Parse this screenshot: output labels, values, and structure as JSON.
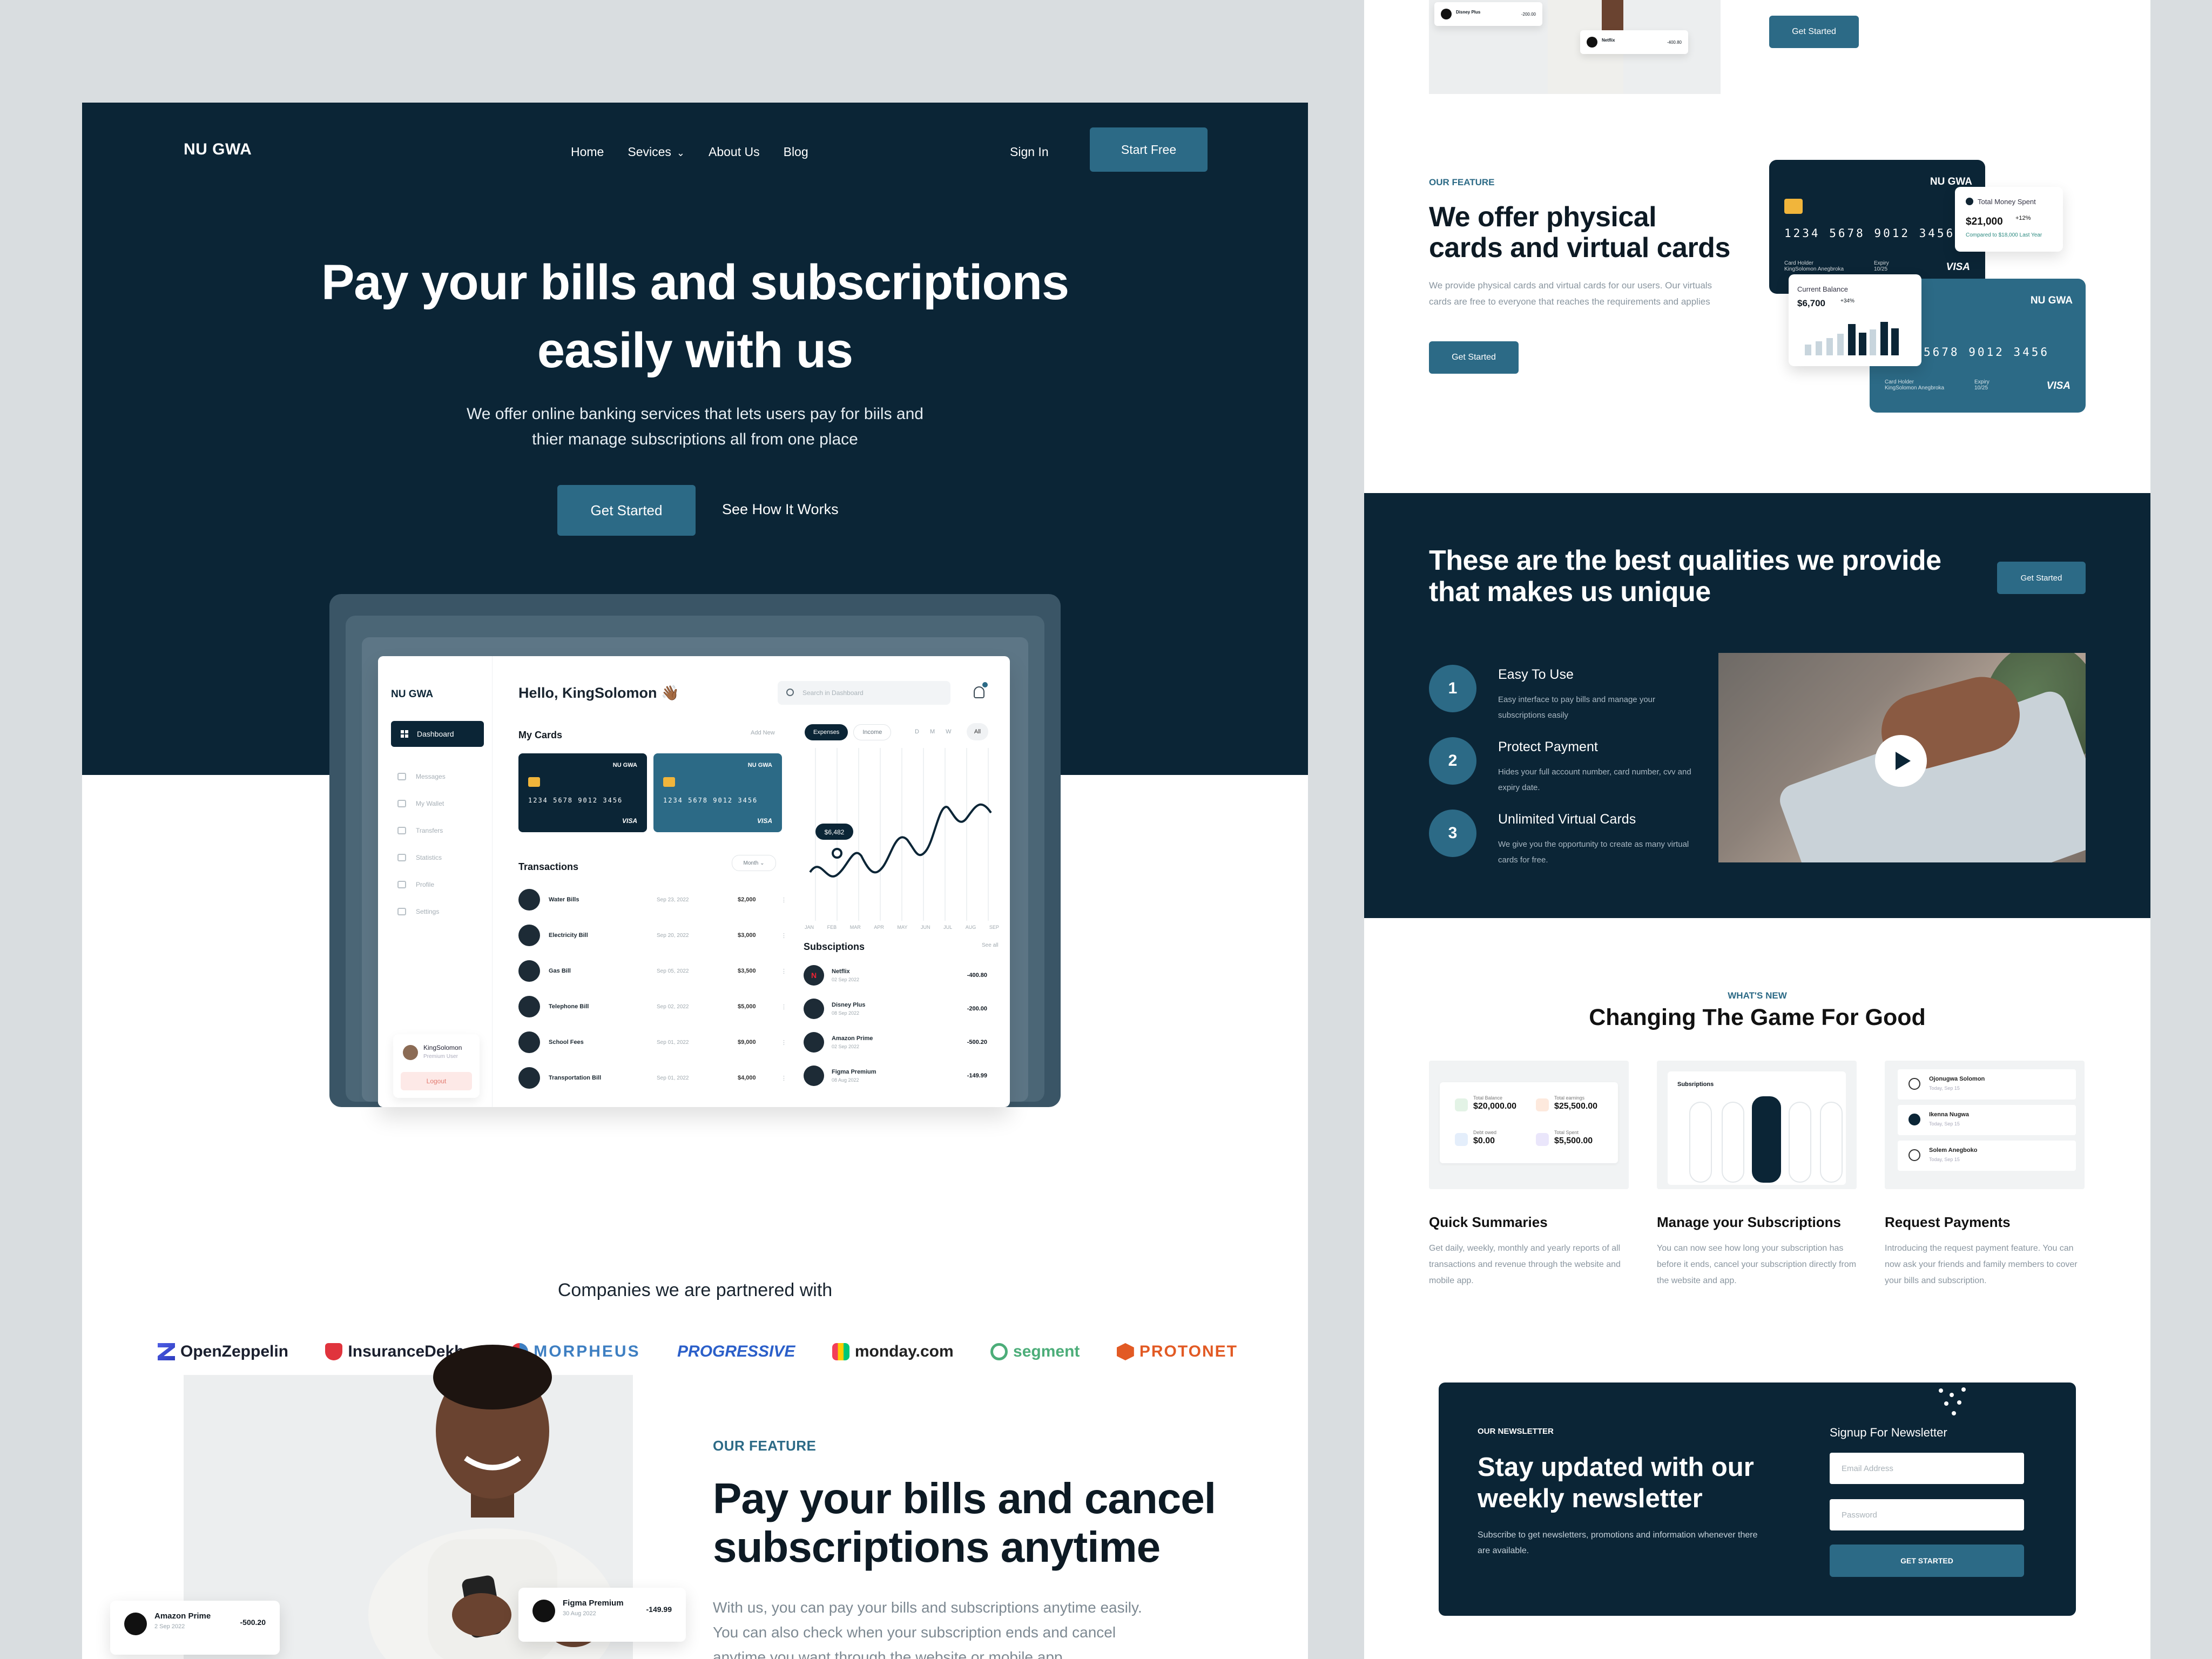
{
  "colors": {
    "navy": "#0b2536",
    "teal": "#2c6a86",
    "background": "#d9dde0"
  },
  "left": {
    "nav": {
      "logo": "NU GWA",
      "links": [
        "Home",
        "Sevices",
        "About Us",
        "Blog"
      ],
      "services_chevron": "chevron-down-icon",
      "signin": "Sign In",
      "start_free": "Start Free"
    },
    "hero": {
      "title_line1": "Pay your bills and subscriptions",
      "title_line2": "easily with us",
      "subtitle_line1": "We offer online banking services that lets users pay for biils and",
      "subtitle_line2": "thier manage subscriptions all from one place",
      "get_started": "Get Started",
      "see_how": "See How It Works"
    },
    "dashboard": {
      "logo": "NU GWA",
      "active_menu": "Dashboard",
      "menu": [
        "Messages",
        "My Wallet",
        "Transfers",
        "Statistics",
        "Profile",
        "Settings"
      ],
      "user_name": "KingSolomon",
      "user_role": "Premium User",
      "logout": "Logout",
      "greeting": "Hello, KingSolomon 👋🏾",
      "search_placeholder": "Search in Dashboard",
      "my_cards": "My Cards",
      "add_new": "Add New",
      "card": {
        "brand": "NU GWA",
        "number": "1234 5678 9012 3456",
        "network": "VISA"
      },
      "tabs": [
        "Expenses",
        "Income"
      ],
      "ranges": [
        "D",
        "M",
        "W"
      ],
      "range_all": "All",
      "chart_tooltip": "$6,482",
      "months": [
        "JAN",
        "FEB",
        "MAR",
        "APR",
        "MAY",
        "JUN",
        "JUL",
        "AUG",
        "SEP"
      ],
      "transactions_title": "Transactions",
      "period": "Month",
      "transactions": [
        {
          "name": "Water Bills",
          "date": "Sep 23, 2022",
          "amount": "$2,000"
        },
        {
          "name": "Electricity Bill",
          "date": "Sep 20, 2022",
          "amount": "$3,000"
        },
        {
          "name": "Gas Bill",
          "date": "Sep 05, 2022",
          "amount": "$3,500"
        },
        {
          "name": "Telephone Bill",
          "date": "Sep 02, 2022",
          "amount": "$5,000"
        },
        {
          "name": "School Fees",
          "date": "Sep 01, 2022",
          "amount": "$9,000"
        },
        {
          "name": "Transportation Bill",
          "date": "Sep 01, 2022",
          "amount": "$4,000"
        }
      ],
      "subscriptions_title": "Subsciptions",
      "see_all": "See all",
      "subscriptions": [
        {
          "name": "Netflix",
          "date": "02 Sep 2022",
          "amount": "-400.80"
        },
        {
          "name": "Disney Plus",
          "date": "08 Sep 2022",
          "amount": "-200.00"
        },
        {
          "name": "Amazon Prime",
          "date": "02 Sep 2022",
          "amount": "-500.20"
        },
        {
          "name": "Figma Premium",
          "date": "08 Aug 2022",
          "amount": "-149.99"
        }
      ]
    },
    "partners": {
      "title": "Companies we are partnered with",
      "list": [
        "OpenZeppelin",
        "InsuranceDekho",
        "MORPHEUS",
        "PROGRESSIVE",
        "monday.com",
        "segment",
        "PROTONET"
      ]
    },
    "feature": {
      "label": "OUR FEATURE",
      "title": "Pay your bills and cancel subscriptions anytime",
      "desc": "With us, you can pay your bills and subscriptions anytime easily. You can also check when your subscription ends and cancel anytime you want through the website or mobile app.",
      "card1": {
        "name": "Amazon Prime",
        "date": "2 Sep 2022",
        "amount": "-500.20"
      },
      "card2": {
        "name": "Figma Premium",
        "date": "30 Aug 2022",
        "amount": "-149.99"
      }
    }
  },
  "right": {
    "top": {
      "card1": {
        "name": "Disney Plus",
        "amount": "-200.00"
      },
      "card2": {
        "name": "Netflix",
        "amount": "-400.80"
      },
      "get_started": "Get Started"
    },
    "cards_section": {
      "label": "OUR FEATURE",
      "title": "We offer physical cards and virtual cards",
      "desc": "We provide physical cards and virtual cards for our users. Our virtuals cards are free to everyone that reaches the requirements and applies",
      "get_started": "Get Started",
      "card": {
        "brand": "NU GWA",
        "number": "1234 5678 9012 3456",
        "number_partial": "5678 9012 3456",
        "holder_label": "Card Holder",
        "holder": "KingSolomon Anegbroka",
        "expiry_label": "Expiry",
        "expiry": "10/25",
        "network": "VISA"
      },
      "total_spent": {
        "label": "Total Money Spent",
        "value": "$21,000",
        "pct": "+12%",
        "caption": "Compared to $18,000 Last Year"
      },
      "balance": {
        "label": "Current Balance",
        "value": "$6,700",
        "pct": "+34%"
      }
    },
    "qualities": {
      "title": "These are the best qualities we provide that makes us unique",
      "get_started": "Get Started",
      "items": [
        {
          "num": "1",
          "title": "Easy To Use",
          "desc": "Easy interface to pay bills and manage your subscriptions easily"
        },
        {
          "num": "2",
          "title": "Protect Payment",
          "desc": "Hides your full account number, card number, cvv and expiry date."
        },
        {
          "num": "3",
          "title": "Unlimited Virtual Cards",
          "desc": "We give you the opportunity to create as many virtual cards for free."
        }
      ]
    },
    "whats_new": {
      "label": "WHAT'S NEW",
      "title": "Changing The Game For Good",
      "features": [
        {
          "title": "Quick Summaries",
          "desc": "Get daily, weekly, monthly and yearly reports of all transactions and revenue through the website and mobile app."
        },
        {
          "title": "Manage your Subscriptions",
          "desc": "You can now see how long your subscription has before it ends, cancel your subscription directly from the website and app."
        },
        {
          "title": "Request Payments",
          "desc": "Introducing the request payment feature. You can now ask your friends and family members to cover your bills and subscription."
        }
      ],
      "summary": {
        "total_balance": "$20,000.00",
        "total_earnings": "$25,500.00",
        "debt_owed": "$0.00",
        "total_spent": "$5,500.00",
        "labels": [
          "Total Balance",
          "Total earnings",
          "Debt owed",
          "Total Spent"
        ]
      },
      "subs_label": "Subsriptions",
      "requests": [
        {
          "name": "Ojonugwa Solomon",
          "sub": "Today, Sep 15"
        },
        {
          "name": "Ikenna Nugwa",
          "sub": "Today, Sep 15"
        },
        {
          "name": "Solem Anegboko",
          "sub": "Today, Sep 15"
        }
      ]
    },
    "newsletter": {
      "label": "OUR NEWSLETTER",
      "title": "Stay updated with our weekly newsletter",
      "desc": "Subscribe to get newsletters, promotions and information whenever there are available.",
      "signup": "Signup For Newsletter",
      "email_placeholder": "Email Address",
      "password_placeholder": "Password",
      "button": "GET STARTED"
    }
  }
}
